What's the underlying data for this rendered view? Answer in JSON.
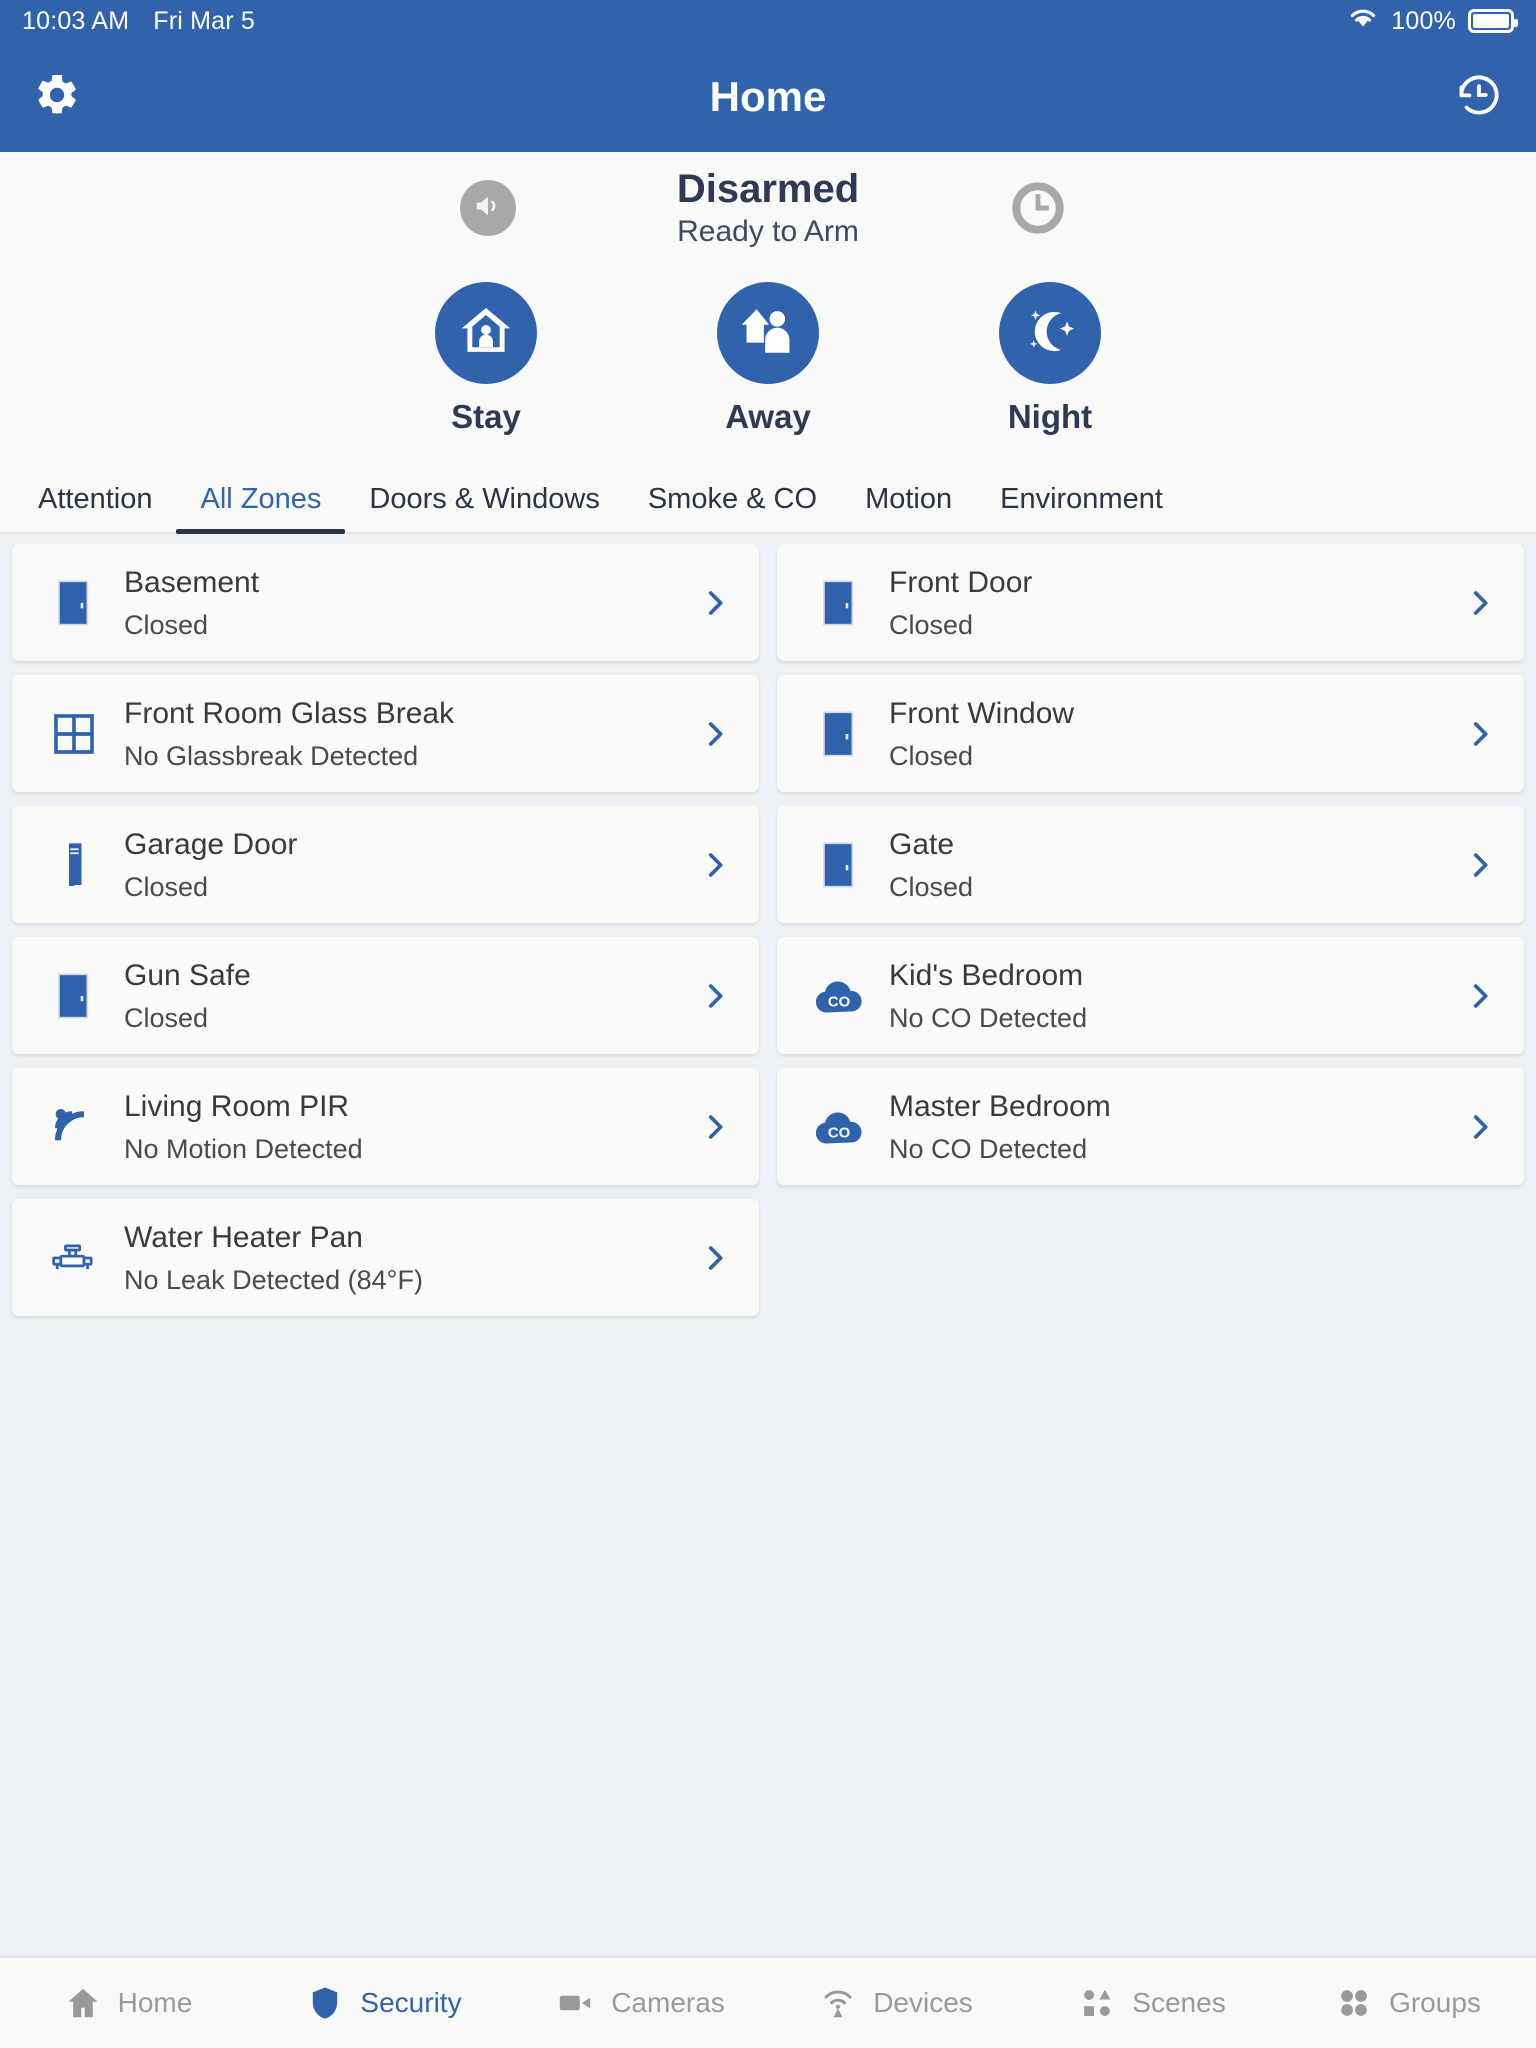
{
  "statusbar": {
    "time": "10:03 AM",
    "date": "Fri Mar 5",
    "battery_percent": "100%",
    "wifi_icon": "wifi-icon",
    "battery_icon": "battery-full-icon"
  },
  "header": {
    "title": "Home",
    "settings_icon": "gear-icon",
    "history_icon": "history-clock-icon"
  },
  "arm_panel": {
    "state": "Disarmed",
    "substate": "Ready to Arm",
    "mute_icon": "speaker-mute-icon",
    "clock_icon": "clock-icon",
    "modes": [
      {
        "label": "Stay",
        "icon": "house-person-icon"
      },
      {
        "label": "Away",
        "icon": "house-person-leaving-icon"
      },
      {
        "label": "Night",
        "icon": "moon-stars-icon"
      }
    ]
  },
  "tabs": {
    "active": "All Zones",
    "items": [
      {
        "label": "Attention"
      },
      {
        "label": "All Zones"
      },
      {
        "label": "Doors & Windows"
      },
      {
        "label": "Smoke & CO"
      },
      {
        "label": "Motion"
      },
      {
        "label": "Environment"
      }
    ]
  },
  "zones": [
    {
      "name": "Basement",
      "status": "Closed",
      "icon": "door-icon"
    },
    {
      "name": "Front Door",
      "status": "Closed",
      "icon": "door-icon"
    },
    {
      "name": "Front Room Glass Break",
      "status": "No Glassbreak Detected",
      "icon": "window-grid-icon"
    },
    {
      "name": "Front Window",
      "status": "Closed",
      "icon": "door-icon"
    },
    {
      "name": "Garage Door",
      "status": "Closed",
      "icon": "garage-door-icon"
    },
    {
      "name": "Gate",
      "status": "Closed",
      "icon": "door-icon"
    },
    {
      "name": "Gun Safe",
      "status": "Closed",
      "icon": "door-icon"
    },
    {
      "name": "Kid's Bedroom",
      "status": "No CO Detected",
      "icon": "co-detector-icon"
    },
    {
      "name": "Living Room PIR",
      "status": "No Motion Detected",
      "icon": "motion-waves-icon"
    },
    {
      "name": "Master Bedroom",
      "status": "No CO Detected",
      "icon": "co-detector-icon"
    },
    {
      "name": "Water Heater Pan",
      "status": "No Leak Detected (84°F)",
      "icon": "water-pipe-icon"
    }
  ],
  "bottom_nav": {
    "active": "Security",
    "items": [
      {
        "label": "Home",
        "icon": "home-icon"
      },
      {
        "label": "Security",
        "icon": "shield-icon"
      },
      {
        "label": "Cameras",
        "icon": "video-camera-icon"
      },
      {
        "label": "Devices",
        "icon": "signal-device-icon"
      },
      {
        "label": "Scenes",
        "icon": "scenes-shapes-icon"
      },
      {
        "label": "Groups",
        "icon": "groups-circles-icon"
      }
    ]
  },
  "colors": {
    "brand_blue": "#3063AC",
    "background": "#EDF1F5",
    "card": "#FAFAF9",
    "text_dark": "#2D3A56",
    "muted_gray": "#9A9A9A"
  }
}
